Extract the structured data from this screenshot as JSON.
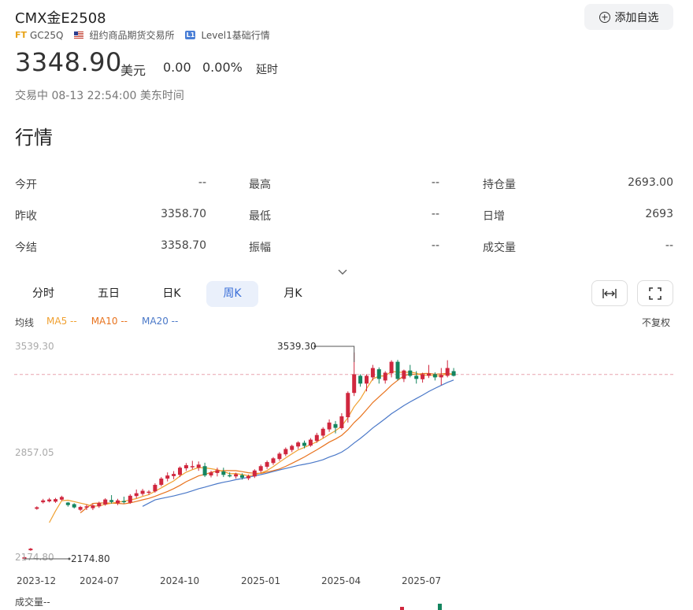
{
  "header": {
    "title": "CMX金E2508",
    "ft_logo": "FT",
    "ticker": "GC25Q",
    "exchange": "纽约商品期货交易所",
    "level_badge": "L1",
    "level_text": "Level1基础行情",
    "add_watchlist_label": "添加自选"
  },
  "quote": {
    "price": "3348.90",
    "currency": "美元",
    "change": "0.00",
    "change_pct": "0.00%",
    "delay": "延时",
    "status": "交易中 08-13 22:54:00 美东时间"
  },
  "market": {
    "section_title": "行情",
    "rows": [
      [
        {
          "label": "今开",
          "value": "--"
        },
        {
          "label": "最高",
          "value": "--"
        },
        {
          "label": "持仓量",
          "value": "2693.00"
        }
      ],
      [
        {
          "label": "昨收",
          "value": "3358.70"
        },
        {
          "label": "最低",
          "value": "--"
        },
        {
          "label": "日增",
          "value": "2693"
        }
      ],
      [
        {
          "label": "今结",
          "value": "3358.70"
        },
        {
          "label": "振幅",
          "value": "--"
        },
        {
          "label": "成交量",
          "value": "--"
        }
      ]
    ]
  },
  "tabs": [
    {
      "label": "分时",
      "active": false
    },
    {
      "label": "五日",
      "active": false
    },
    {
      "label": "日K",
      "active": false
    },
    {
      "label": "周K",
      "active": true
    },
    {
      "label": "月K",
      "active": false
    }
  ],
  "indicators": {
    "label": "均线",
    "ma5": "MA5 --",
    "ma10": "MA10 --",
    "ma20": "MA20 --",
    "ma5_color": "#f0a030",
    "ma10_color": "#e8731e",
    "ma20_color": "#4a78c8",
    "adjust": "不复权"
  },
  "chart_data": {
    "type": "candlestick",
    "y_ticks": [
      "3539.30",
      "2857.05",
      "2174.80"
    ],
    "ylim": [
      2174.8,
      3539.3
    ],
    "x_tick_labels": [
      "2023-12",
      "2024-07",
      "2024-10",
      "2025-01",
      "2025-04",
      "2025-07"
    ],
    "annotations": {
      "max_label": "3539.30",
      "min_label": "2174.80"
    },
    "reference_price": 3358.7,
    "up_color": "#d0273e",
    "down_color": "#14855f",
    "candles": [
      {
        "o": 2175,
        "h": 2190,
        "l": 2175,
        "c": 2185
      },
      {
        "o": 2230,
        "h": 2245,
        "l": 2226,
        "c": 2240
      },
      {
        "o": 2496,
        "h": 2512,
        "l": 2490,
        "c": 2506
      },
      {
        "o": 2538,
        "h": 2560,
        "l": 2530,
        "c": 2550
      },
      {
        "o": 2544,
        "h": 2566,
        "l": 2537,
        "c": 2556
      },
      {
        "o": 2542,
        "h": 2566,
        "l": 2534,
        "c": 2558
      },
      {
        "o": 2555,
        "h": 2580,
        "l": 2548,
        "c": 2572
      },
      {
        "o": 2536,
        "h": 2540,
        "l": 2510,
        "c": 2520
      },
      {
        "o": 2526,
        "h": 2532,
        "l": 2498,
        "c": 2505
      },
      {
        "o": 2490,
        "h": 2515,
        "l": 2482,
        "c": 2508
      },
      {
        "o": 2504,
        "h": 2524,
        "l": 2488,
        "c": 2512
      },
      {
        "o": 2500,
        "h": 2526,
        "l": 2488,
        "c": 2518
      },
      {
        "o": 2512,
        "h": 2542,
        "l": 2502,
        "c": 2532
      },
      {
        "o": 2524,
        "h": 2564,
        "l": 2516,
        "c": 2556
      },
      {
        "o": 2552,
        "h": 2584,
        "l": 2530,
        "c": 2540
      },
      {
        "o": 2532,
        "h": 2560,
        "l": 2520,
        "c": 2550
      },
      {
        "o": 2546,
        "h": 2574,
        "l": 2530,
        "c": 2540
      },
      {
        "o": 2536,
        "h": 2590,
        "l": 2528,
        "c": 2580
      },
      {
        "o": 2578,
        "h": 2620,
        "l": 2564,
        "c": 2596
      },
      {
        "o": 2592,
        "h": 2624,
        "l": 2580,
        "c": 2612
      },
      {
        "o": 2602,
        "h": 2616,
        "l": 2586,
        "c": 2606
      },
      {
        "o": 2608,
        "h": 2660,
        "l": 2600,
        "c": 2650
      },
      {
        "o": 2650,
        "h": 2700,
        "l": 2640,
        "c": 2690
      },
      {
        "o": 2690,
        "h": 2730,
        "l": 2672,
        "c": 2710
      },
      {
        "o": 2706,
        "h": 2738,
        "l": 2686,
        "c": 2720
      },
      {
        "o": 2714,
        "h": 2768,
        "l": 2700,
        "c": 2760
      },
      {
        "o": 2756,
        "h": 2790,
        "l": 2740,
        "c": 2776
      },
      {
        "o": 2770,
        "h": 2804,
        "l": 2750,
        "c": 2770
      },
      {
        "o": 2760,
        "h": 2800,
        "l": 2740,
        "c": 2780
      },
      {
        "o": 2770,
        "h": 2792,
        "l": 2700,
        "c": 2710
      },
      {
        "o": 2710,
        "h": 2740,
        "l": 2698,
        "c": 2730
      },
      {
        "o": 2726,
        "h": 2760,
        "l": 2704,
        "c": 2744
      },
      {
        "o": 2736,
        "h": 2760,
        "l": 2700,
        "c": 2714
      },
      {
        "o": 2712,
        "h": 2730,
        "l": 2698,
        "c": 2708
      },
      {
        "o": 2704,
        "h": 2728,
        "l": 2690,
        "c": 2718
      },
      {
        "o": 2712,
        "h": 2724,
        "l": 2684,
        "c": 2696
      },
      {
        "o": 2692,
        "h": 2716,
        "l": 2680,
        "c": 2706
      },
      {
        "o": 2704,
        "h": 2750,
        "l": 2694,
        "c": 2742
      },
      {
        "o": 2740,
        "h": 2780,
        "l": 2728,
        "c": 2770
      },
      {
        "o": 2766,
        "h": 2806,
        "l": 2752,
        "c": 2796
      },
      {
        "o": 2790,
        "h": 2828,
        "l": 2778,
        "c": 2820
      },
      {
        "o": 2816,
        "h": 2860,
        "l": 2804,
        "c": 2850
      },
      {
        "o": 2846,
        "h": 2890,
        "l": 2834,
        "c": 2880
      },
      {
        "o": 2874,
        "h": 2908,
        "l": 2860,
        "c": 2900
      },
      {
        "o": 2896,
        "h": 2930,
        "l": 2880,
        "c": 2922
      },
      {
        "o": 2920,
        "h": 2934,
        "l": 2884,
        "c": 2900
      },
      {
        "o": 2902,
        "h": 2950,
        "l": 2894,
        "c": 2940
      },
      {
        "o": 2932,
        "h": 2984,
        "l": 2920,
        "c": 2970
      },
      {
        "o": 2966,
        "h": 3020,
        "l": 2950,
        "c": 3010
      },
      {
        "o": 3006,
        "h": 3070,
        "l": 2990,
        "c": 3050
      },
      {
        "o": 3040,
        "h": 3060,
        "l": 2980,
        "c": 3016
      },
      {
        "o": 3014,
        "h": 3110,
        "l": 3004,
        "c": 3090
      },
      {
        "o": 3084,
        "h": 3250,
        "l": 3050,
        "c": 3240
      },
      {
        "o": 3240,
        "h": 3500,
        "l": 3220,
        "c": 3360
      },
      {
        "o": 3350,
        "h": 3360,
        "l": 3280,
        "c": 3300
      },
      {
        "o": 3300,
        "h": 3360,
        "l": 3250,
        "c": 3350
      },
      {
        "o": 3340,
        "h": 3420,
        "l": 3320,
        "c": 3400
      },
      {
        "o": 3392,
        "h": 3404,
        "l": 3300,
        "c": 3330
      },
      {
        "o": 3320,
        "h": 3380,
        "l": 3300,
        "c": 3370
      },
      {
        "o": 3366,
        "h": 3450,
        "l": 3340,
        "c": 3440
      },
      {
        "o": 3440,
        "h": 3452,
        "l": 3320,
        "c": 3330
      },
      {
        "o": 3330,
        "h": 3390,
        "l": 3310,
        "c": 3384
      },
      {
        "o": 3384,
        "h": 3420,
        "l": 3340,
        "c": 3350
      },
      {
        "o": 3350,
        "h": 3380,
        "l": 3300,
        "c": 3330
      },
      {
        "o": 3328,
        "h": 3370,
        "l": 3306,
        "c": 3360
      },
      {
        "o": 3350,
        "h": 3420,
        "l": 3336,
        "c": 3364
      },
      {
        "o": 3360,
        "h": 3372,
        "l": 3320,
        "c": 3340
      },
      {
        "o": 3340,
        "h": 3400,
        "l": 3290,
        "c": 3356
      },
      {
        "o": 3350,
        "h": 3450,
        "l": 3340,
        "c": 3400
      },
      {
        "o": 3380,
        "h": 3400,
        "l": 3346,
        "c": 3350
      }
    ],
    "volume_label": "成交量--"
  }
}
